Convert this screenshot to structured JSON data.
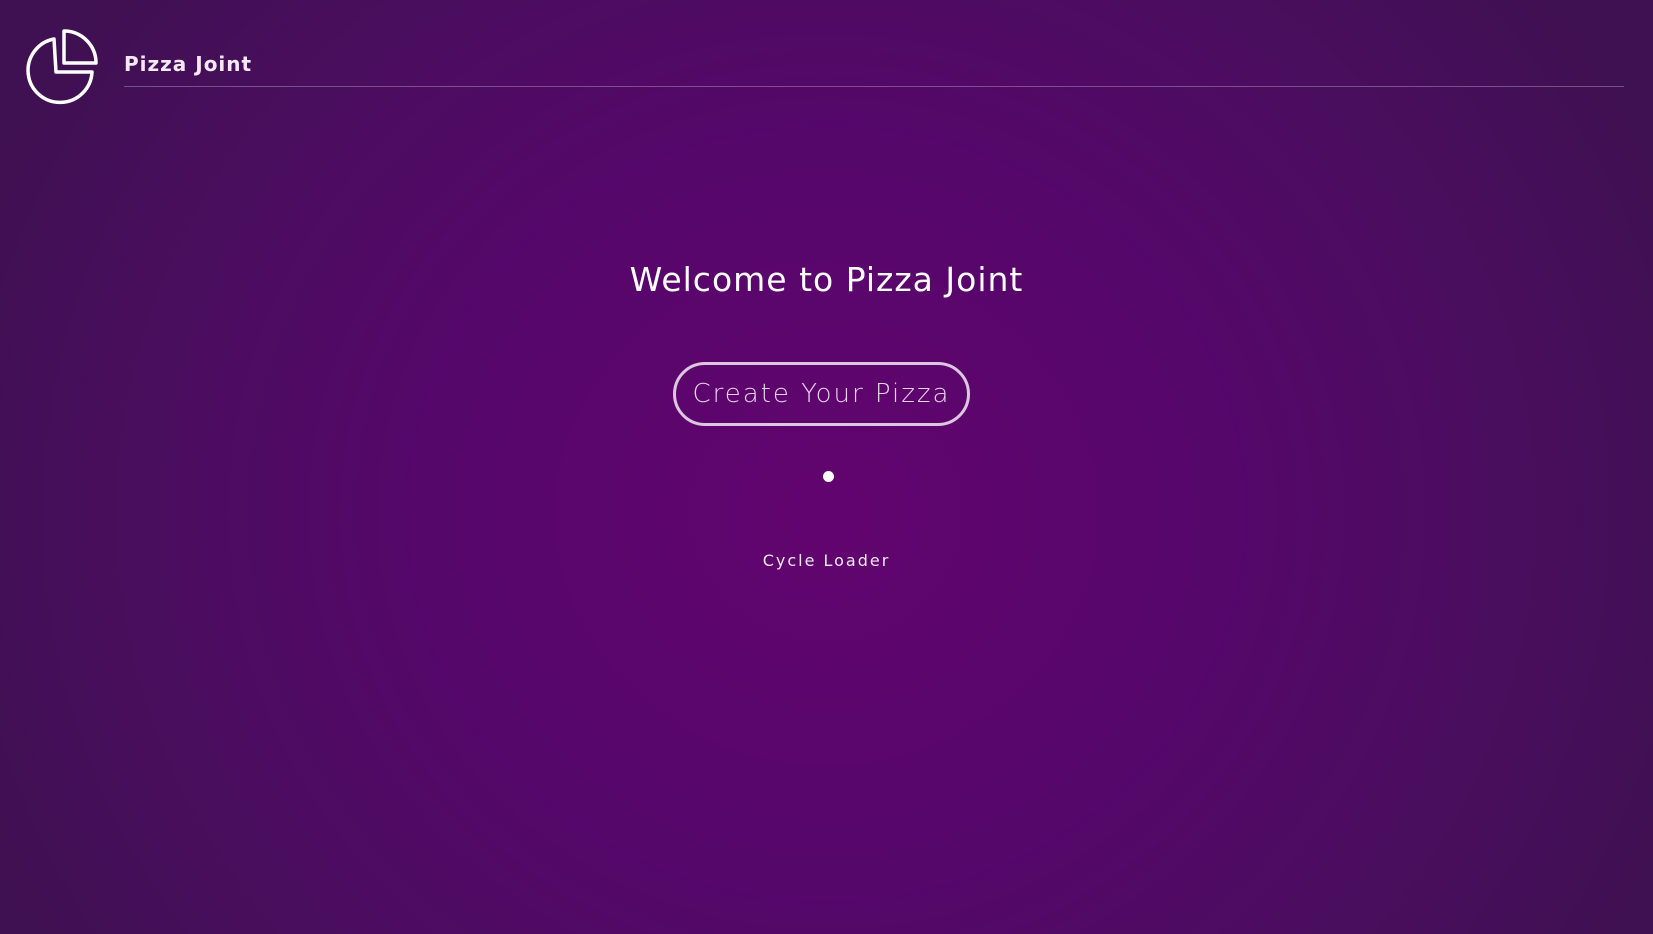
{
  "header": {
    "logo_icon": "pie-chart-logo-icon",
    "brand": "Pizza Joint"
  },
  "home": {
    "title": "Welcome to Pizza Joint",
    "cta_label": "Create Your Pizza",
    "loader_icon": "loader-dot-icon",
    "cycle_loader_label": "Cycle Loader"
  },
  "colors": {
    "background_center": "#62046f",
    "background_edge": "#3f1052",
    "text": "#ffffff",
    "button_border": "#e0cde6"
  }
}
